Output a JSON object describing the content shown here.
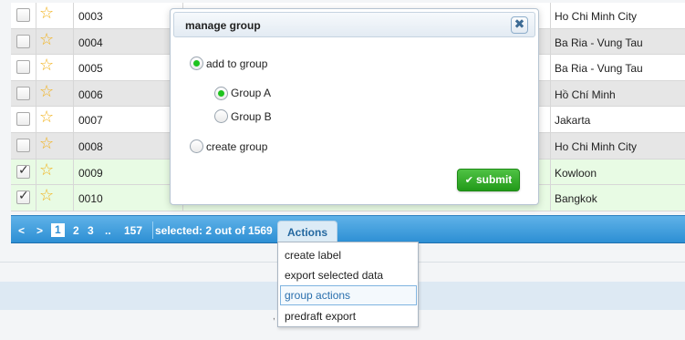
{
  "table": {
    "rows": [
      {
        "id": "0003",
        "city": "Ho Chi Minh City",
        "checked": false,
        "style": "white"
      },
      {
        "id": "0004",
        "city": "Ba Ria - Vung Tau",
        "checked": false,
        "style": "gray"
      },
      {
        "id": "0005",
        "city": "Ba Ria - Vung Tau",
        "checked": false,
        "style": "white"
      },
      {
        "id": "0006",
        "city": "Hồ Chí Minh",
        "checked": false,
        "style": "gray"
      },
      {
        "id": "0007",
        "city": "Jakarta",
        "checked": false,
        "style": "white"
      },
      {
        "id": "0008",
        "city": "Ho Chi Minh City",
        "checked": false,
        "style": "gray"
      },
      {
        "id": "0009",
        "city": "Kowloon",
        "checked": true,
        "style": "sel"
      },
      {
        "id": "0010",
        "city": "Bangkok",
        "checked": true,
        "style": "sel"
      }
    ],
    "star_glyph": "☆",
    "check_glyph": "✓"
  },
  "pager": {
    "prev": "<",
    "next": ">",
    "pages": [
      "1",
      "2",
      "3"
    ],
    "current": "1",
    "ellipsis": "..",
    "last": "157",
    "selected_text": "selected: 2 out of 1569",
    "actions_label": "Actions"
  },
  "menu": {
    "items": [
      "create label",
      "export selected data",
      "group actions",
      "predraft export"
    ],
    "highlighted": "group actions"
  },
  "modal": {
    "title": "manage group",
    "close_glyph": "✖",
    "add_to_group": "add to group",
    "group_a": "Group A",
    "group_b": "Group B",
    "create_group": "create group",
    "submit_label": "submit",
    "submit_icon": "✔"
  },
  "footer": {
    "mark": ","
  },
  "colors": {
    "pager_bar": "#2d8fd4",
    "selected_row": "#e8fbe4",
    "radio_on": "#1ec31e",
    "submit_bg": "#229a19",
    "star": "#f2b21b"
  }
}
